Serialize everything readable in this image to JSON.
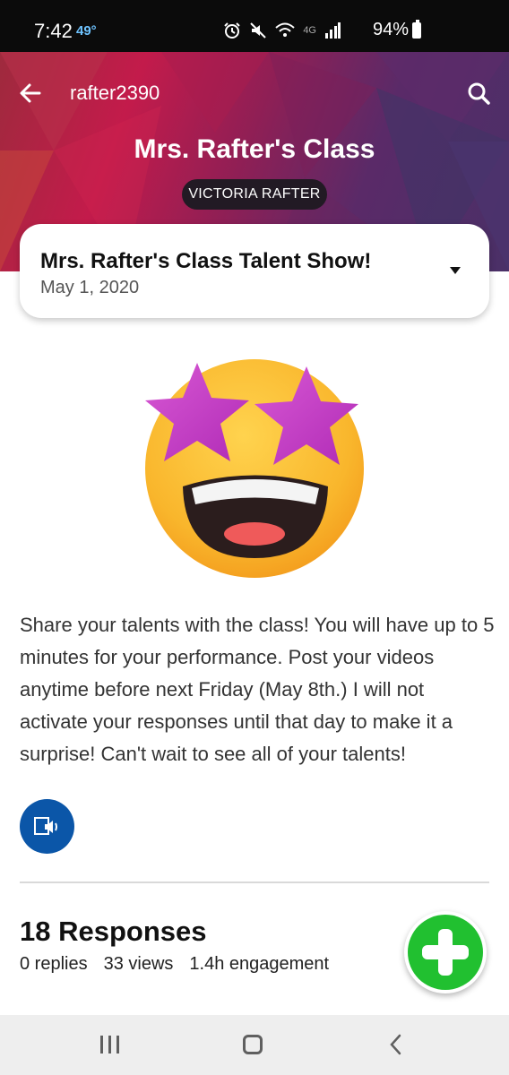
{
  "status_bar": {
    "time": "7:42",
    "temperature": "49°",
    "network": "4G",
    "battery": "94%"
  },
  "header": {
    "username": "rafter2390",
    "class_name": "Mrs. Rafter's Class",
    "teacher_name": "VICTORIA RAFTER"
  },
  "topic": {
    "title": "Mrs. Rafter's Class Talent Show!",
    "date": "May 1, 2020"
  },
  "description": "Share your talents with the class! You will have up to 5 minutes for your performance. Post your videos anytime before next Friday (May 8th.) I will not activate your responses until that day to make it a surprise! Can't wait to see all of your talents!",
  "responses": {
    "title": "18 Responses",
    "replies": "0 replies",
    "views": "33 views",
    "engagement": "1.4h engagement"
  },
  "colors": {
    "accent_blue": "#0b56a8",
    "fab_green": "#21c030",
    "star_magenta": "#c43ec6",
    "emoji_yellow": "#f9c23c"
  },
  "icons": {
    "back": "arrow-left-icon",
    "search": "search-icon",
    "dropdown": "caret-down-icon",
    "immersive_reader": "immersive-reader-icon",
    "add": "plus-icon",
    "emoji": "star-struck-emoji"
  }
}
